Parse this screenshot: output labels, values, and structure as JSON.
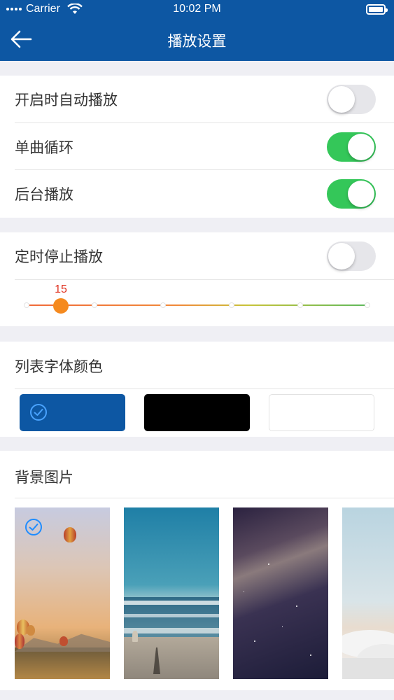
{
  "status_bar": {
    "carrier": "Carrier",
    "time": "10:02 PM"
  },
  "nav": {
    "title": "播放设置",
    "back_icon": "back-arrow-icon"
  },
  "playback": {
    "autoplay": {
      "label": "开启时自动播放",
      "enabled": false
    },
    "single_loop": {
      "label": "单曲循环",
      "enabled": true
    },
    "background_play": {
      "label": "后台播放",
      "enabled": true
    }
  },
  "timer": {
    "label": "定时停止播放",
    "enabled": false,
    "value": "15",
    "slider_fraction": 0.1
  },
  "font_color": {
    "label": "列表字体颜色",
    "options": [
      {
        "color": "#0d57a3",
        "selected": true
      },
      {
        "color": "#000000",
        "selected": false
      },
      {
        "color": "#ffffff",
        "selected": false
      }
    ]
  },
  "background": {
    "label": "背景图片",
    "images": [
      {
        "name": "hot-air-balloons",
        "selected": true
      },
      {
        "name": "ocean-beach",
        "selected": false
      },
      {
        "name": "starry-night",
        "selected": false
      },
      {
        "name": "clouds-sky",
        "selected": false
      }
    ]
  },
  "colors": {
    "nav_bg": "#0d57a3",
    "toggle_on": "#34c759",
    "slider_thumb": "#f58a1f",
    "slider_value": "#e0301e"
  }
}
